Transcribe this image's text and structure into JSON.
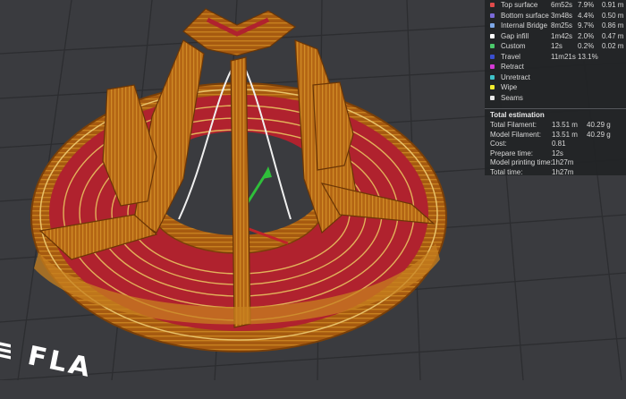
{
  "legend": {
    "items": [
      {
        "label": "Top surface",
        "time": "6m52s",
        "percent": "7.9%",
        "length": "0.91 m",
        "color": "#e04b4b"
      },
      {
        "label": "Bottom surface",
        "time": "3m48s",
        "percent": "4.4%",
        "length": "0.50 m",
        "color": "#7a6ad8"
      },
      {
        "label": "Internal Bridge",
        "time": "8m25s",
        "percent": "9.7%",
        "length": "0.86 m",
        "color": "#7da8e8"
      },
      {
        "label": "Gap infill",
        "time": "1m42s",
        "percent": "2.0%",
        "length": "0.47 m",
        "color": "#ffffff"
      },
      {
        "label": "Custom",
        "time": "12s",
        "percent": "0.2%",
        "length": "0.02 m",
        "color": "#4bc96b"
      },
      {
        "label": "Travel",
        "time": "11m21s",
        "percent": "13.1%",
        "length": "",
        "color": "#3a4fd0"
      },
      {
        "label": "Retract",
        "time": "",
        "percent": "",
        "length": "",
        "color": "#d63ad6"
      },
      {
        "label": "Unretract",
        "time": "",
        "percent": "",
        "length": "",
        "color": "#3fc3c9"
      },
      {
        "label": "Wipe",
        "time": "",
        "percent": "",
        "length": "",
        "color": "#f2ec2f"
      },
      {
        "label": "Seams",
        "time": "",
        "percent": "",
        "length": "",
        "color": "#e8e8e8"
      }
    ]
  },
  "estimation": {
    "title": "Total estimation",
    "rows": [
      {
        "label": "Total Filament:",
        "value": "13.51 m",
        "extra": "40.29 g"
      },
      {
        "label": "Model Filament:",
        "value": "13.51 m",
        "extra": "40.29 g"
      },
      {
        "label": "Cost:",
        "value": "0.81",
        "extra": ""
      },
      {
        "label": "Prepare time:",
        "value": "12s",
        "extra": ""
      },
      {
        "label": "Model printing time:",
        "value": "1h27m",
        "extra": ""
      },
      {
        "label": "Total time:",
        "value": "1h27m",
        "extra": ""
      }
    ]
  },
  "logo": {
    "mark": "≡",
    "text": "FLA"
  }
}
